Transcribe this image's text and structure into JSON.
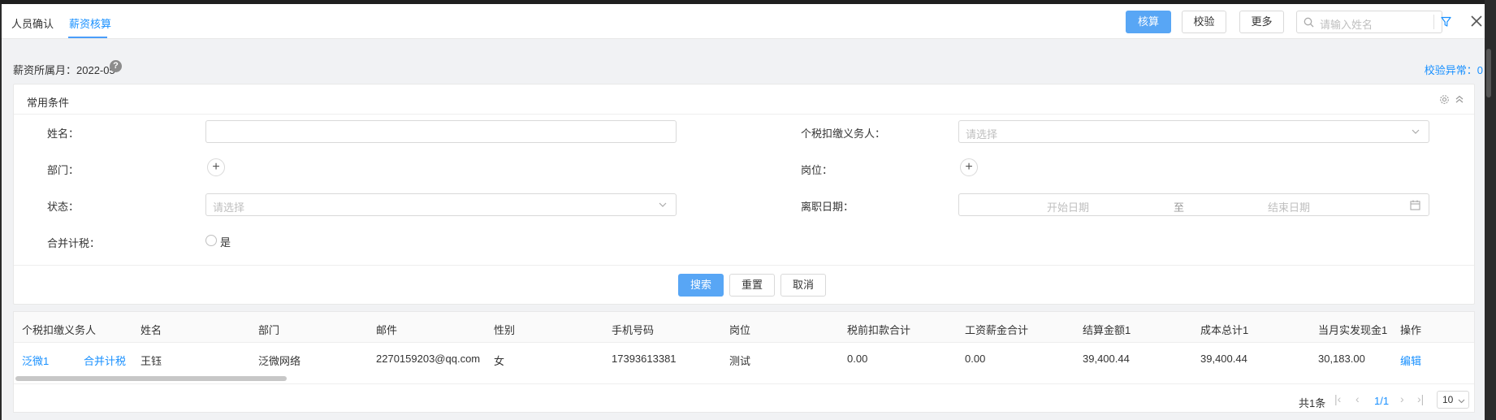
{
  "tabs": [
    {
      "label": "人员确认",
      "active": false
    },
    {
      "label": "薪资核算",
      "active": true
    }
  ],
  "toolbar": {
    "calc_label": "核算",
    "verify_label": "校验",
    "more_label": "更多",
    "search_placeholder": "请输入姓名"
  },
  "period": {
    "label": "薪资所属月：2022-05",
    "verify_error": "校验异常：0"
  },
  "conditions": {
    "title": "常用条件",
    "name_label": "姓名：",
    "withholder_label": "个税扣缴义务人：",
    "withholder_placeholder": "请选择",
    "dept_label": "部门：",
    "post_label": "岗位：",
    "status_label": "状态：",
    "status_placeholder": "请选择",
    "leave_date_label": "离职日期：",
    "start_date_placeholder": "开始日期",
    "date_to": "至",
    "end_date_placeholder": "结束日期",
    "merge_tax_label": "合并计税：",
    "merge_tax_option": "是",
    "search_label": "搜索",
    "reset_label": "重置",
    "cancel_label": "取消"
  },
  "table": {
    "columns": [
      "个税扣缴义务人",
      "姓名",
      "部门",
      "邮件",
      "性别",
      "手机号码",
      "岗位",
      "税前扣款合计",
      "工资薪金合计",
      "结算金额1",
      "成本总计1",
      "当月实发现金1",
      "操作"
    ],
    "rows": [
      {
        "withholder": "泛微1",
        "merge_tag": "合并计税",
        "name": "王钰",
        "dept": "泛微网络",
        "email": "2270159203@qq.com",
        "gender": "女",
        "phone": "17393613381",
        "post": "测试",
        "pretax_deduction": "0.00",
        "salary_total": "0.00",
        "settlement": "39,400.44",
        "cost_total": "39,400.44",
        "cash_paid": "30,183.00",
        "action": "编辑"
      }
    ]
  },
  "pager": {
    "total": "共1条",
    "page": "1/1",
    "page_size": "10"
  },
  "colors": {
    "primary": "#58a6f5",
    "link": "#1890ff"
  }
}
